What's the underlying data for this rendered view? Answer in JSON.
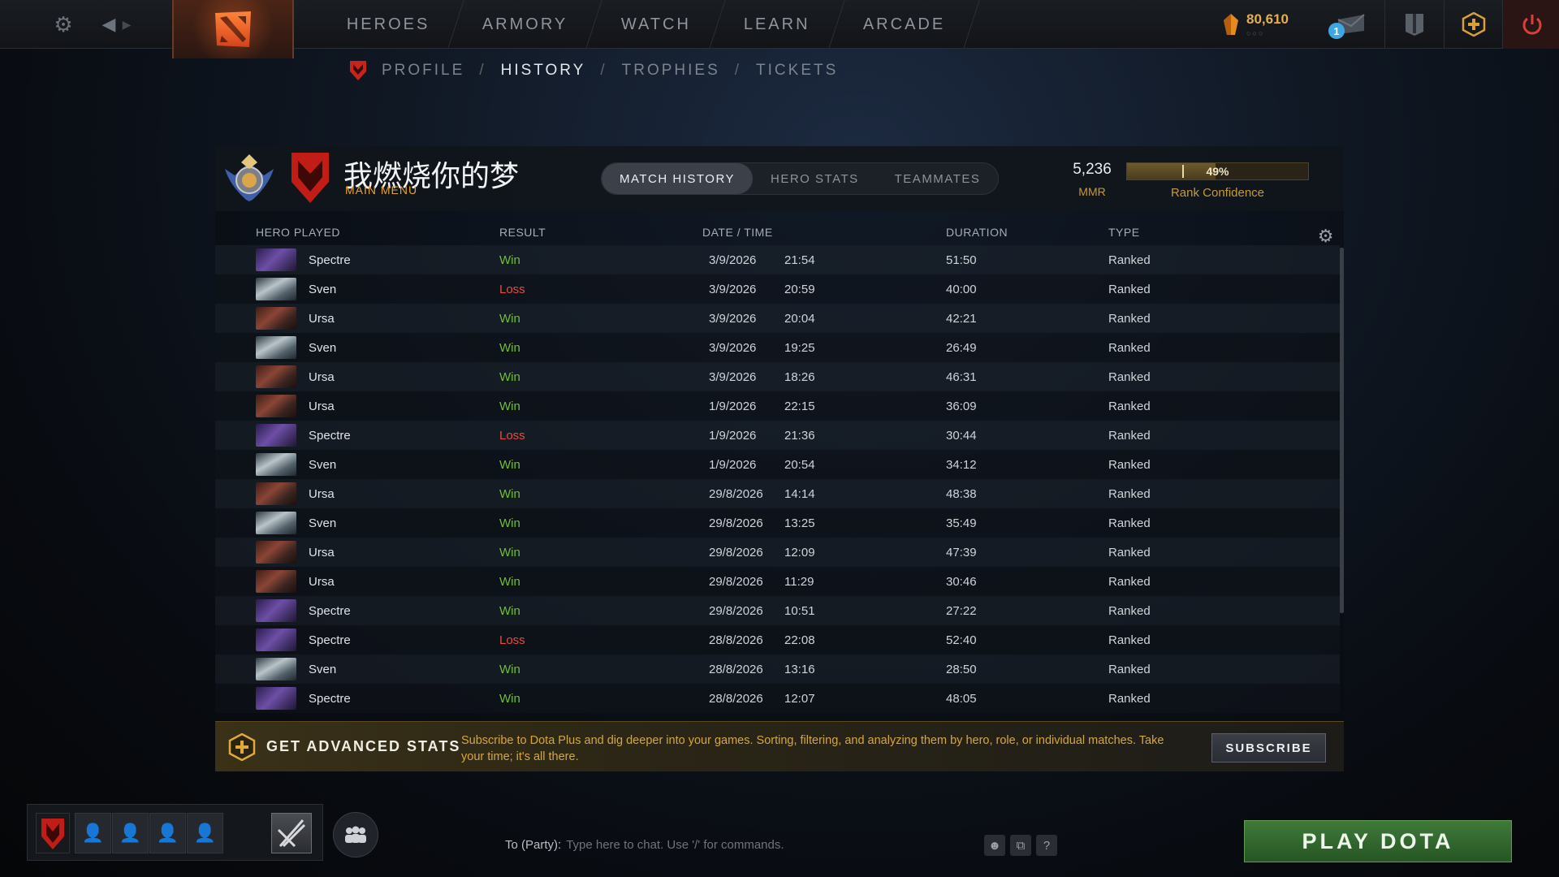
{
  "topbar": {
    "nav": [
      "HEROES",
      "ARMORY",
      "WATCH",
      "LEARN",
      "ARCADE"
    ],
    "currency": "80,610",
    "notification_count": "1"
  },
  "breadcrumb": [
    "PROFILE",
    "HISTORY",
    "TROPHIES",
    "TICKETS"
  ],
  "breadcrumb_active": "HISTORY",
  "profile": {
    "name": "我燃烧你的梦",
    "sub": "MAIN MENU",
    "mmr_value": "5,236",
    "mmr_label": "MMR",
    "rank_confidence_pct": "49%",
    "rank_confidence_fraction": 0.49,
    "rank_confidence_label": "Rank Confidence"
  },
  "tabs": [
    "MATCH HISTORY",
    "HERO STATS",
    "TEAMMATES"
  ],
  "columns": {
    "hero": "HERO PLAYED",
    "result": "RESULT",
    "datetime": "DATE / TIME",
    "duration": "DURATION",
    "type": "TYPE"
  },
  "matches": [
    {
      "hero": "Spectre",
      "result": "Win",
      "date": "3/9/2026",
      "time": "21:54",
      "duration": "51:50",
      "type": "Ranked"
    },
    {
      "hero": "Sven",
      "result": "Loss",
      "date": "3/9/2026",
      "time": "20:59",
      "duration": "40:00",
      "type": "Ranked"
    },
    {
      "hero": "Ursa",
      "result": "Win",
      "date": "3/9/2026",
      "time": "20:04",
      "duration": "42:21",
      "type": "Ranked"
    },
    {
      "hero": "Sven",
      "result": "Win",
      "date": "3/9/2026",
      "time": "19:25",
      "duration": "26:49",
      "type": "Ranked"
    },
    {
      "hero": "Ursa",
      "result": "Win",
      "date": "3/9/2026",
      "time": "18:26",
      "duration": "46:31",
      "type": "Ranked"
    },
    {
      "hero": "Ursa",
      "result": "Win",
      "date": "1/9/2026",
      "time": "22:15",
      "duration": "36:09",
      "type": "Ranked"
    },
    {
      "hero": "Spectre",
      "result": "Loss",
      "date": "1/9/2026",
      "time": "21:36",
      "duration": "30:44",
      "type": "Ranked"
    },
    {
      "hero": "Sven",
      "result": "Win",
      "date": "1/9/2026",
      "time": "20:54",
      "duration": "34:12",
      "type": "Ranked"
    },
    {
      "hero": "Ursa",
      "result": "Win",
      "date": "29/8/2026",
      "time": "14:14",
      "duration": "48:38",
      "type": "Ranked"
    },
    {
      "hero": "Sven",
      "result": "Win",
      "date": "29/8/2026",
      "time": "13:25",
      "duration": "35:49",
      "type": "Ranked"
    },
    {
      "hero": "Ursa",
      "result": "Win",
      "date": "29/8/2026",
      "time": "12:09",
      "duration": "47:39",
      "type": "Ranked"
    },
    {
      "hero": "Ursa",
      "result": "Win",
      "date": "29/8/2026",
      "time": "11:29",
      "duration": "30:46",
      "type": "Ranked"
    },
    {
      "hero": "Spectre",
      "result": "Win",
      "date": "29/8/2026",
      "time": "10:51",
      "duration": "27:22",
      "type": "Ranked"
    },
    {
      "hero": "Spectre",
      "result": "Loss",
      "date": "28/8/2026",
      "time": "22:08",
      "duration": "52:40",
      "type": "Ranked"
    },
    {
      "hero": "Sven",
      "result": "Win",
      "date": "28/8/2026",
      "time": "13:16",
      "duration": "28:50",
      "type": "Ranked"
    },
    {
      "hero": "Spectre",
      "result": "Win",
      "date": "28/8/2026",
      "time": "12:07",
      "duration": "48:05",
      "type": "Ranked"
    }
  ],
  "plus": {
    "title": "GET ADVANCED STATS",
    "description": "Subscribe to Dota Plus and dig deeper into your games. Sorting, filtering, and analyzing them by hero, role, or individual matches. Take your time; it's all there.",
    "button": "SUBSCRIBE"
  },
  "chat": {
    "target": "To (Party):",
    "placeholder": "Type here to chat. Use '/' for commands."
  },
  "play_button": "PLAY DOTA",
  "colors": {
    "win": "#6fbf3a",
    "loss": "#e24e40",
    "gold": "#e6a22a",
    "play_green": "#3f7a3a"
  }
}
